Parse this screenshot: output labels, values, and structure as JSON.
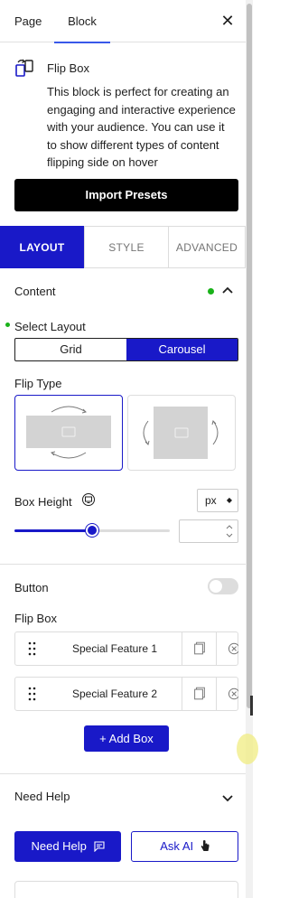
{
  "top_tabs": {
    "page": "Page",
    "block": "Block"
  },
  "block": {
    "name": "Flip Box",
    "description": "This block is perfect for creating an engaging and interactive experience with your audience. You can use it to show different types of content flipping side on hover"
  },
  "import_label": "Import Presets",
  "settings_tabs": {
    "layout": "LAYOUT",
    "style": "STYLE",
    "advanced": "ADVANCED"
  },
  "content": {
    "title": "Content",
    "select_layout_label": "Select Layout",
    "layout_options": [
      "Grid",
      "Carousel"
    ],
    "layout_selected": "Carousel",
    "flip_type_label": "Flip Type",
    "box_height_label": "Box Height",
    "unit": "px",
    "box_height_value": "",
    "button_label": "Button",
    "button_toggle_on": false,
    "flip_box_label": "Flip Box",
    "boxes": [
      "Special Feature 1",
      "Special Feature 2"
    ],
    "add_box_label": "+ Add Box"
  },
  "need_help": {
    "title": "Need Help",
    "help_button": "Need Help",
    "ai_button": "Ask AI"
  },
  "colors": {
    "accent": "#1919c8",
    "status_dot": "#19b219",
    "import_bg": "#000000"
  }
}
